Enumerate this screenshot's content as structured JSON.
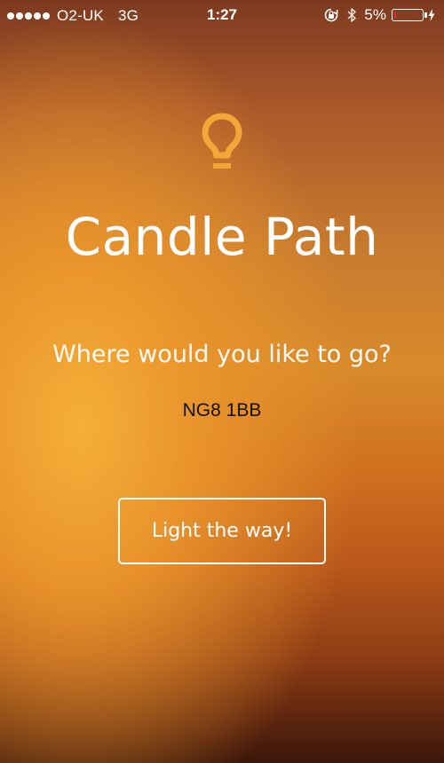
{
  "status_bar": {
    "carrier": "O2-UK",
    "network": "3G",
    "time": "1:27",
    "battery_percent": "5%",
    "battery_level": 0.05,
    "signal_bars": 5,
    "icons": [
      "orientation-lock-icon",
      "bluetooth-icon",
      "battery-icon",
      "charging-icon"
    ]
  },
  "app": {
    "title": "Candle Path",
    "logo_icon": "lightbulb-icon",
    "accent_color": "#f2a838"
  },
  "form": {
    "prompt": "Where would you like to go?",
    "destination_value": "NG8 1BB",
    "submit_label": "Light the way!"
  }
}
